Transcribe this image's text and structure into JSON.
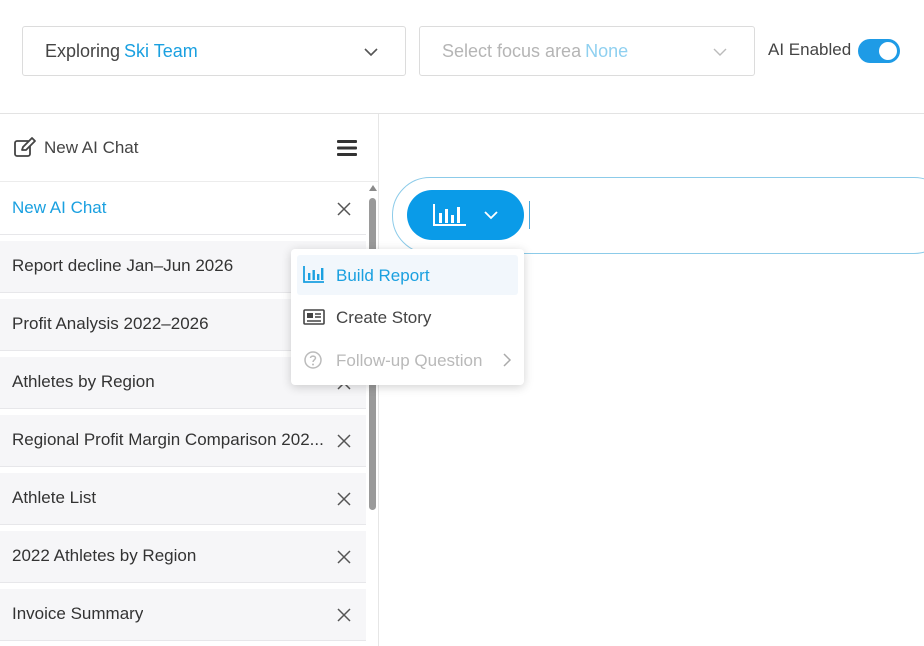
{
  "header": {
    "explore": {
      "prefix": "Exploring",
      "value": "Ski Team"
    },
    "focus": {
      "prefix": "Select focus area",
      "value": "None"
    },
    "ai_toggle": {
      "label": "AI Enabled",
      "enabled": true
    }
  },
  "sidebar": {
    "new_chat_label": "New AI Chat",
    "chats": [
      {
        "label": "New AI Chat",
        "active": true
      },
      {
        "label": "Report decline Jan–Jun 2026"
      },
      {
        "label": "Profit Analysis 2022–2026"
      },
      {
        "label": "Athletes by Region"
      },
      {
        "label": "Regional Profit Margin Comparison 202..."
      },
      {
        "label": "Athlete List"
      },
      {
        "label": "2022 Athletes by Region"
      },
      {
        "label": "Invoice Summary"
      }
    ]
  },
  "mode_menu": {
    "items": [
      {
        "label": "Build Report",
        "icon": "bar-chart-icon",
        "state": "highlighted"
      },
      {
        "label": "Create Story",
        "icon": "newspaper-icon",
        "state": "normal"
      },
      {
        "label": "Follow-up Question",
        "icon": "question-circle-icon",
        "state": "disabled",
        "submenu": true
      }
    ]
  },
  "colors": {
    "accent": "#1aa0e0",
    "button": "#0a9be8",
    "toggle": "#1e9be6"
  }
}
